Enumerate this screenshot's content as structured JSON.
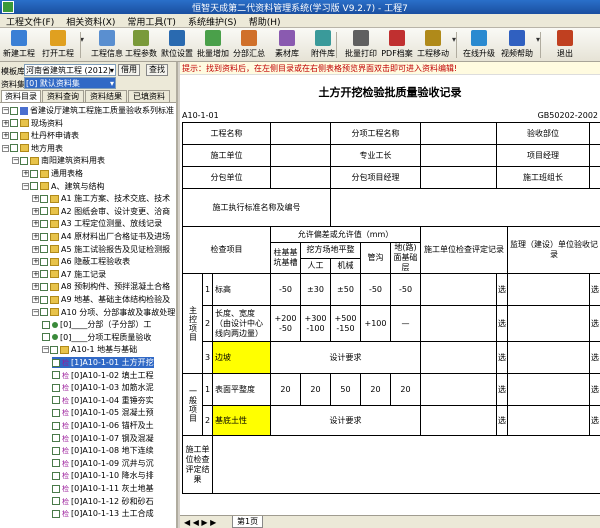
{
  "window": {
    "title": "恒智天成第二代资料管理系统(学习版 V9.2.7) - 工程7"
  },
  "menu": [
    "工程文件(F)",
    "相关资料(X)",
    "常用工具(T)",
    "系统维护(S)",
    "帮助(H)"
  ],
  "toolbar": [
    {
      "label": "新建工程",
      "color": "#3a7fd5"
    },
    {
      "label": "打开工程",
      "color": "#e0a020",
      "dd": true
    },
    {
      "label": "工程信息",
      "color": "#5a8fd0"
    },
    {
      "label": "工程参数",
      "color": "#7a9a3a"
    },
    {
      "label": "默位设置",
      "color": "#2a6ab0"
    },
    {
      "label": "批量增加",
      "color": "#4aa04a"
    },
    {
      "label": "分部汇总",
      "color": "#d0702a"
    },
    {
      "label": "素材库",
      "color": "#8a5ab0"
    },
    {
      "label": "附件库",
      "color": "#3a9a9a"
    },
    {
      "label": "批量打印",
      "color": "#606060"
    },
    {
      "label": "PDF档案",
      "color": "#c03030"
    },
    {
      "label": "工程移动",
      "color": "#b08a1a",
      "dd": true
    },
    {
      "label": "在线升级",
      "color": "#2a8ad0"
    },
    {
      "label": "视频帮助",
      "color": "#3060c0",
      "dd": true
    },
    {
      "label": "退出",
      "color": "#c04020"
    }
  ],
  "filter": {
    "template_label": "模板库",
    "template_value": "河南省建筑工程 (2012)",
    "reference_button": "借用",
    "search_button": "查找",
    "material_label": "资料集",
    "material_value": "[0] 默认资料集"
  },
  "tabs": [
    "资料目录",
    "资料查询",
    "资料结果",
    "已填资料"
  ],
  "tree": [
    {
      "level": 0,
      "exp": "-",
      "type": "file",
      "text": "省建设厅建筑工程施工质量验收系列标准"
    },
    {
      "level": 0,
      "exp": "+",
      "type": "folder",
      "text": "现场资料"
    },
    {
      "level": 0,
      "exp": "+",
      "type": "folder",
      "text": "杜丹杯申请表"
    },
    {
      "level": 0,
      "exp": "-",
      "type": "folder",
      "text": "地方用表"
    },
    {
      "level": 1,
      "exp": "-",
      "type": "folder",
      "text": "南阳建筑资料用表"
    },
    {
      "level": 2,
      "exp": "+",
      "type": "folder",
      "text": "通用表格"
    },
    {
      "level": 2,
      "exp": "-",
      "type": "folder",
      "text": "A、建筑与结构"
    },
    {
      "level": 3,
      "exp": "+",
      "type": "folder",
      "text": "A1 施工方案、技术交底、技术"
    },
    {
      "level": 3,
      "exp": "+",
      "type": "folder",
      "text": "A2 图纸会审、设计变更、洽商"
    },
    {
      "level": 3,
      "exp": "+",
      "type": "folder",
      "text": "A3 工程定位测量、放线记录"
    },
    {
      "level": 3,
      "exp": "+",
      "type": "folder",
      "text": "A4 原材料出厂合格证书及进场"
    },
    {
      "level": 3,
      "exp": "+",
      "type": "folder",
      "text": "A5 施工试验报告及见证检测报"
    },
    {
      "level": 3,
      "exp": "+",
      "type": "folder",
      "text": "A6 隐蔽工程验收表"
    },
    {
      "level": 3,
      "exp": "+",
      "type": "folder",
      "text": "A7 施工记录"
    },
    {
      "level": 3,
      "exp": "+",
      "type": "folder",
      "text": "A8 预制构件、预拌混凝土合格"
    },
    {
      "level": 3,
      "exp": "+",
      "type": "folder",
      "text": "A9 地基、基础主体结构检验及"
    },
    {
      "level": 3,
      "exp": "-",
      "type": "folder",
      "text": "A10 分项、分部事故及事故处理"
    },
    {
      "level": 4,
      "exp": "",
      "type": "dot",
      "text": "[0]____分部（子分部）工"
    },
    {
      "level": 4,
      "exp": "",
      "type": "dot",
      "text": "[0]____分项工程质量验收"
    },
    {
      "level": 4,
      "exp": "-",
      "type": "folder",
      "text": "A10-1 地基与基础"
    },
    {
      "level": 5,
      "exp": "",
      "type": "jian",
      "text": "[1]A10-1-01 土方开挖",
      "selected": true
    },
    {
      "level": 5,
      "exp": "",
      "type": "jian",
      "text": "[0]A10-1-02 填土工程"
    },
    {
      "level": 5,
      "exp": "",
      "type": "jian",
      "text": "[0]A10-1-03 加筋水泥"
    },
    {
      "level": 5,
      "exp": "",
      "type": "jian",
      "text": "[0]A10-1-04 重锤夯实"
    },
    {
      "level": 5,
      "exp": "",
      "type": "jian",
      "text": "[0]A10-1-05 混凝土预"
    },
    {
      "level": 5,
      "exp": "",
      "type": "jian",
      "text": "[0]A10-1-06 锚杆及土"
    },
    {
      "level": 5,
      "exp": "",
      "type": "jian",
      "text": "[0]A10-1-07 钢及混凝"
    },
    {
      "level": 5,
      "exp": "",
      "type": "jian",
      "text": "[0]A10-1-08 地下连续"
    },
    {
      "level": 5,
      "exp": "",
      "type": "jian",
      "text": "[0]A10-1-09 沉井与沉"
    },
    {
      "level": 5,
      "exp": "",
      "type": "jian",
      "text": "[0]A10-1-10 降水与排"
    },
    {
      "level": 5,
      "exp": "",
      "type": "jian",
      "text": "[0]A10-1-11 灰土地基"
    },
    {
      "level": 5,
      "exp": "",
      "type": "jian",
      "text": "[0]A10-1-12 砂和砂石"
    },
    {
      "level": 5,
      "exp": "",
      "type": "jian",
      "text": "[0]A10-1-13 土工合成"
    }
  ],
  "hint": "提示：找到资料后，在左侧目录或在右侧表格预览界面双击即可进入资料编辑!",
  "document": {
    "title": "土方开挖检验批质量验收记录",
    "code_left": "A10-1-01",
    "code_right": "GB50202-2002",
    "labels": {
      "project_name": "工程名称",
      "sub_project_name": "分项工程名称",
      "acceptance_part": "验收部位",
      "constructor": "施工单位",
      "foreman": "专业工长",
      "project_manager": "项目经理",
      "subcontractor": "分包单位",
      "sub_manager": "分包项目经理",
      "team_leader": "施工班组长",
      "standard": "施工执行标准名称及编号",
      "tolerance": "允许偏差或允许值（mm）",
      "check_item": "检查项目",
      "pile_base": "柱基基坑基槽",
      "excavation": "挖方场地平整",
      "manual": "人工",
      "machine": "机械",
      "trench": "管沟",
      "ground_base": "地(路)面基础层",
      "constructor_check": "施工单位检查评定记录",
      "supervisor_check": "监理（建设）单位验收记录",
      "main_items": "主控项目",
      "general_items": "一般项目",
      "constructor_result": "施工单位检查评定结果",
      "select": "选"
    },
    "main_rows": [
      {
        "no": "1",
        "item": "标高",
        "v": [
          "-50",
          "±30",
          "±50",
          "-50",
          "-50"
        ],
        "design": false
      },
      {
        "no": "2",
        "item": "长度、宽度（由设计中心线向两边量）",
        "v": [
          "+200 -50",
          "+300 -100",
          "+500 -150",
          "+100",
          "—"
        ],
        "design": false
      },
      {
        "no": "3",
        "item": "边坡",
        "design": true,
        "design_text": "设计要求"
      }
    ],
    "general_rows": [
      {
        "no": "1",
        "item": "表面平整度",
        "v": [
          "20",
          "20",
          "50",
          "20",
          "20"
        ],
        "design": false
      },
      {
        "no": "2",
        "item": "基底土性",
        "design": true,
        "design_text": "设计要求"
      }
    ]
  },
  "pagebar": {
    "nav": "◀ ◀ ▶ ▶",
    "page_tab": "第1页"
  }
}
